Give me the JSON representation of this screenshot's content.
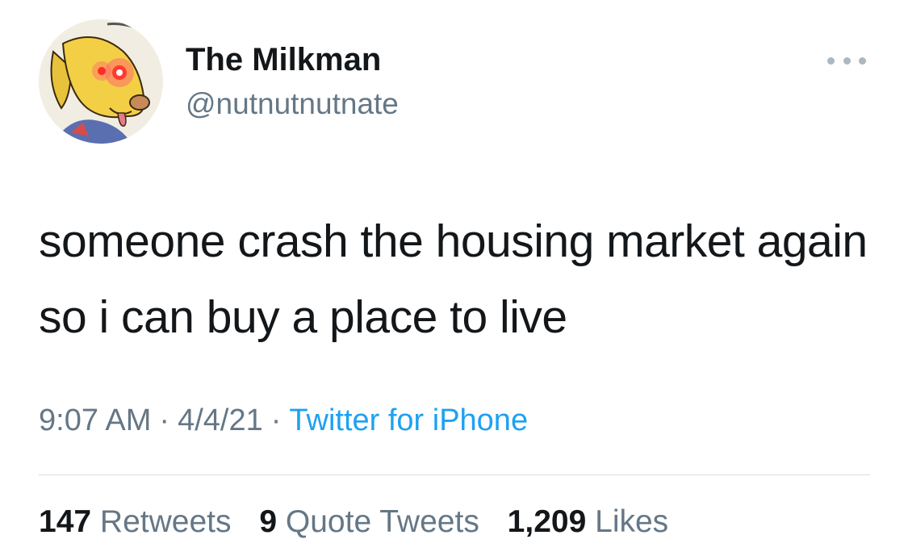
{
  "user": {
    "display_name": "The Milkman",
    "handle": "@nutnutnutnate",
    "avatar_icon": "cartoon-dog-laser-eyes-avatar"
  },
  "tweet": {
    "text": "someone crash the housing market again so i can buy a place to live",
    "time": "9:07 AM",
    "date": "4/4/21",
    "separator": "·",
    "source": "Twitter for iPhone"
  },
  "stats": {
    "retweets_count": "147",
    "retweets_label": "Retweets",
    "quotes_count": "9",
    "quotes_label": "Quote Tweets",
    "likes_count": "1,209",
    "likes_label": "Likes"
  },
  "colors": {
    "text": "#14171a",
    "secondary": "#657786",
    "link": "#1da1f2",
    "divider": "#d6dde2"
  }
}
